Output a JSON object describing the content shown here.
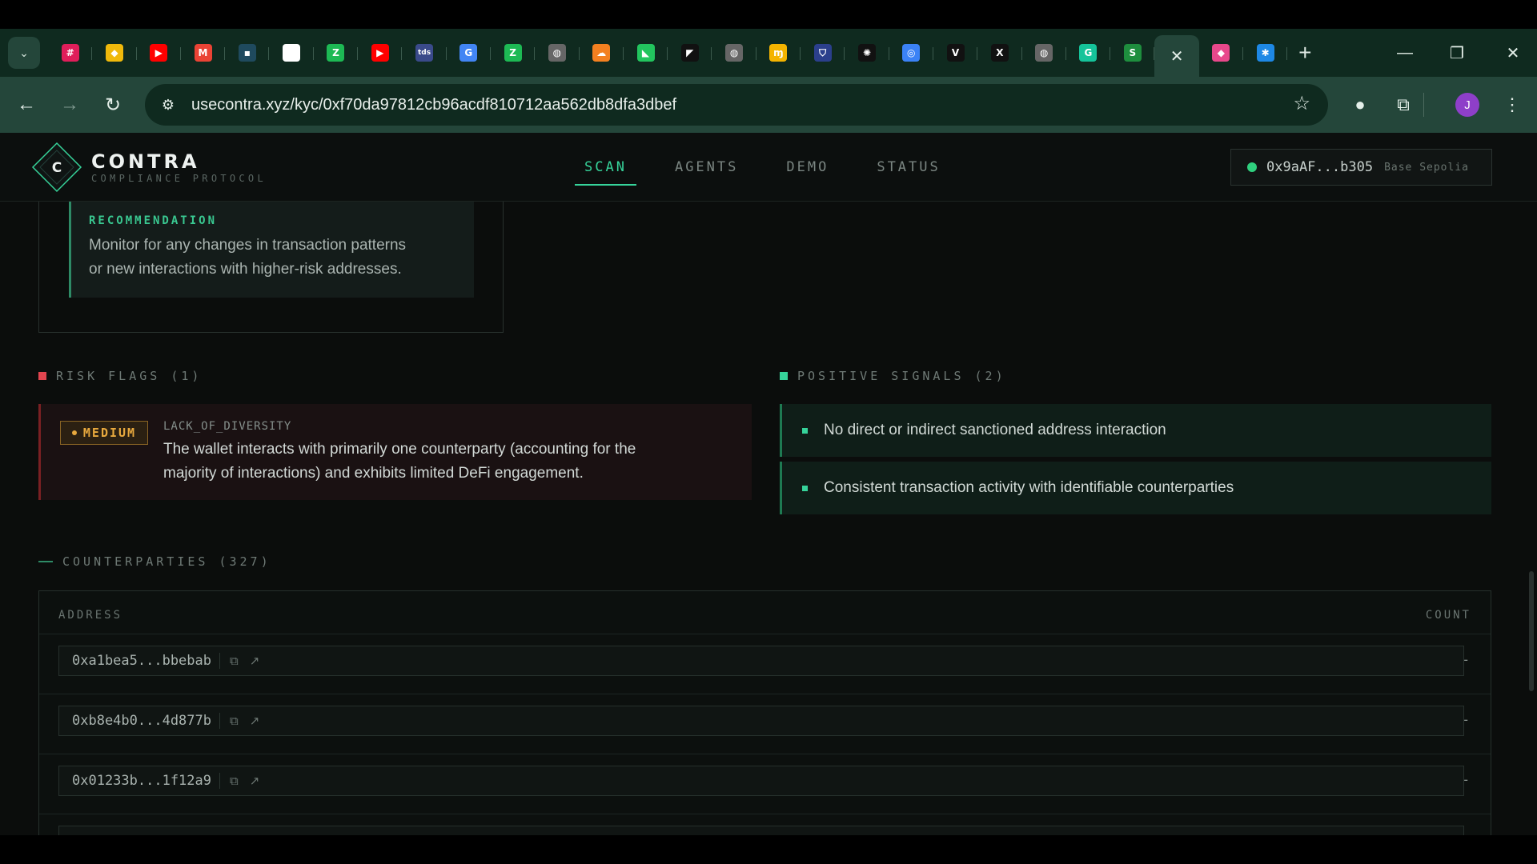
{
  "browser": {
    "tabs": [
      {
        "icon": "slack-icon",
        "glyph": "#",
        "color": "#e01e5a"
      },
      {
        "icon": "binance-icon",
        "glyph": "◆",
        "color": "#f0b90b"
      },
      {
        "icon": "youtube-icon",
        "glyph": "▶",
        "color": "#ff0000"
      },
      {
        "icon": "gmail-icon",
        "glyph": "M",
        "color": "#ea4335"
      },
      {
        "icon": "app-icon",
        "glyph": "▪",
        "color": "#1f4a5e"
      },
      {
        "icon": "github-icon",
        "glyph": "●",
        "color": "#ffffff"
      },
      {
        "icon": "zap-icon",
        "glyph": "Z",
        "color": "#1db954"
      },
      {
        "icon": "youtube-icon",
        "glyph": "▶",
        "color": "#ff0000"
      },
      {
        "icon": "tds-icon",
        "glyph": "tds",
        "color": "#3a4a8a"
      },
      {
        "icon": "google-icon",
        "glyph": "G",
        "color": "#4285f4"
      },
      {
        "icon": "zap-icon",
        "glyph": "Z",
        "color": "#1db954"
      },
      {
        "icon": "globe-icon",
        "glyph": "◍",
        "color": "#666666"
      },
      {
        "icon": "cloudflare-icon",
        "glyph": "☁",
        "color": "#f38020"
      },
      {
        "icon": "app-icon",
        "glyph": "◣",
        "color": "#22c55e"
      },
      {
        "icon": "app-icon",
        "glyph": "◤",
        "color": "#111111"
      },
      {
        "icon": "globe-icon",
        "glyph": "◍",
        "color": "#666666"
      },
      {
        "icon": "app-icon",
        "glyph": "ɱ",
        "color": "#f5b400"
      },
      {
        "icon": "shield-icon",
        "glyph": "⛉",
        "color": "#2b3f8c"
      },
      {
        "icon": "openai-icon",
        "glyph": "✺",
        "color": "#111111"
      },
      {
        "icon": "app-icon",
        "glyph": "◎",
        "color": "#3b82f6"
      },
      {
        "icon": "v-icon",
        "glyph": "V",
        "color": "#111111"
      },
      {
        "icon": "x-icon",
        "glyph": "X",
        "color": "#111111"
      },
      {
        "icon": "globe-icon",
        "glyph": "◍",
        "color": "#666666"
      },
      {
        "icon": "grammarly-icon",
        "glyph": "G",
        "color": "#15c39a"
      },
      {
        "icon": "sheets-icon",
        "glyph": "S",
        "color": "#1e8e3e"
      },
      {
        "icon": "app-icon",
        "glyph": "◆",
        "color": "#e8488b"
      }
    ],
    "active_tab": {
      "icon": "snowflake-icon",
      "glyph": "✱",
      "color": "#1e88e5"
    },
    "url": "usecontra.xyz/kyc/0xf70da97812cb96acdf810712aa562db8dfa3dbef",
    "profile_initial": "J"
  },
  "site": {
    "brand": "CONTRA",
    "brand_sub": "COMPLIANCE PROTOCOL",
    "logo_letter": "C",
    "nav": [
      "SCAN",
      "AGENTS",
      "DEMO",
      "STATUS"
    ],
    "active_nav": "SCAN",
    "wallet_address": "0x9aAF...b305",
    "network": "Base Sepolia",
    "accent_color": "#36d39a"
  },
  "recommendation": {
    "title": "RECOMMENDATION",
    "text_line1": "Monitor for any changes in transaction patterns",
    "text_line2": "or new interactions with higher-risk addresses."
  },
  "risk_flags": {
    "title": "RISK FLAGS (1)",
    "items": [
      {
        "severity": "MEDIUM",
        "code": "LACK_OF_DIVERSITY",
        "text_line1": "The wallet interacts with primarily one counterparty (accounting for the",
        "text_line2": "majority of interactions) and exhibits limited DeFi engagement."
      }
    ]
  },
  "positive_signals": {
    "title": "POSITIVE SIGNALS (2)",
    "items": [
      "No direct or indirect sanctioned address interaction",
      "Consistent transaction activity with identifiable counterparties"
    ]
  },
  "counterparties": {
    "title": "COUNTERPARTIES (327)",
    "col_address": "ADDRESS",
    "col_count": "COUNT",
    "rows": [
      {
        "address": "0xa1bea5...bbebab",
        "count": "-"
      },
      {
        "address": "0xb8e4b0...4d877b",
        "count": "-"
      },
      {
        "address": "0x01233b...1f12a9",
        "count": "-"
      }
    ]
  }
}
